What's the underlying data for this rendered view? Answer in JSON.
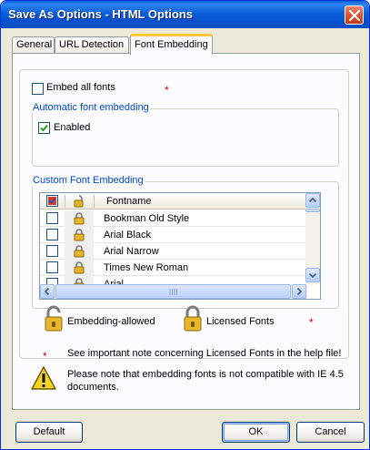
{
  "window": {
    "title": "Save As Options - HTML Options"
  },
  "tabs": [
    {
      "label": "General",
      "active": false
    },
    {
      "label": "URL Detection",
      "active": false
    },
    {
      "label": "Font Embedding",
      "active": true
    }
  ],
  "embed_all": {
    "label": "Embed all fonts",
    "checked": false,
    "asterisk": "*"
  },
  "auto_embed": {
    "legend": "Automatic font embedding",
    "enabled_label": "Enabled",
    "enabled_checked": true
  },
  "custom_embed": {
    "legend": "Custom Font Embedding",
    "column_header": "Fontname",
    "rows": [
      {
        "name": "Bookman Old Style",
        "checked": false
      },
      {
        "name": "Arial Black",
        "checked": false
      },
      {
        "name": "Arial Narrow",
        "checked": false
      },
      {
        "name": "Times New Roman",
        "checked": false
      },
      {
        "name": "Arial",
        "checked": false
      }
    ]
  },
  "legend_icons": {
    "allowed_label": "Embedding-allowed",
    "licensed_label": "Licensed Fonts",
    "asterisk": "*"
  },
  "notes": {
    "asterisk": "*",
    "licensed_note": "See important note concerning Licensed Fonts in the help file!",
    "warning_note": "Please note that embedding fonts is not compatible with IE 4.5 documents."
  },
  "buttons": {
    "default": "Default",
    "ok": "OK",
    "cancel": "Cancel"
  },
  "colors": {
    "title_bar": "#0a5fdc",
    "accent_legend": "#0046d5",
    "asterisk": "#e00000",
    "active_tab_highlight": "#ffc83c"
  }
}
